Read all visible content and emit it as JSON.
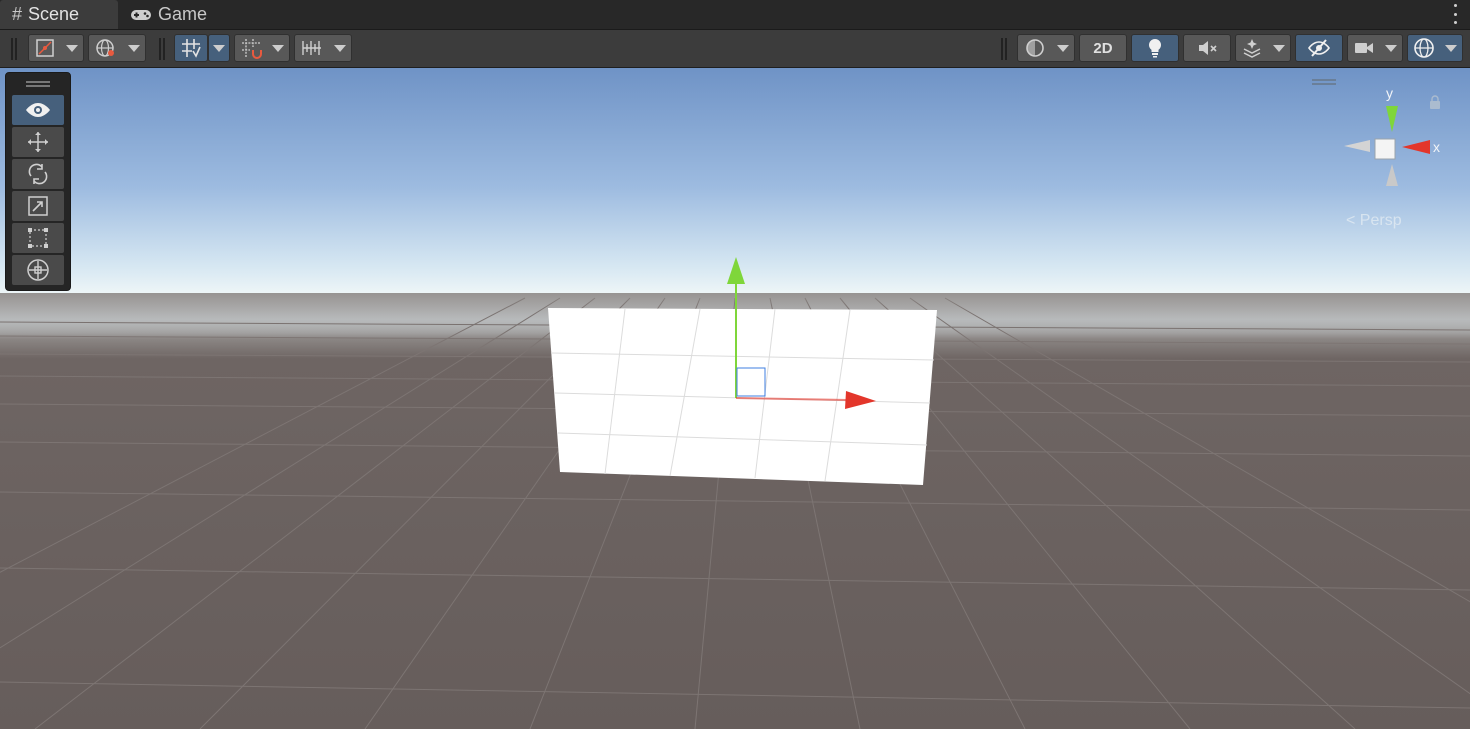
{
  "window": {
    "tabs": [
      {
        "label": "Scene",
        "icon": "hash-icon",
        "active": true
      },
      {
        "label": "Game",
        "icon": "gamepad-icon",
        "active": false
      }
    ],
    "menu_icon": "kebab-menu-icon"
  },
  "toolbar": {
    "left": [
      {
        "name": "draw-mode-dropdown",
        "icon": "shaded-mode-icon"
      },
      {
        "name": "global-local-dropdown",
        "icon": "globe-icon"
      },
      {
        "name": "grid-visibility-toggle",
        "icon": "grid-icon",
        "active": true
      },
      {
        "name": "grid-snapping-dropdown",
        "icon": "grid-snap-icon"
      },
      {
        "name": "increment-snap-dropdown",
        "icon": "ruler-icon"
      }
    ],
    "right": [
      {
        "name": "render-mode-dropdown",
        "icon": "sphere-icon"
      },
      {
        "name": "2d-toggle",
        "label": "2D"
      },
      {
        "name": "lighting-toggle",
        "icon": "lightbulb-icon",
        "active": true
      },
      {
        "name": "audio-toggle",
        "icon": "mute-speaker-icon"
      },
      {
        "name": "effects-dropdown",
        "icon": "effects-icon"
      },
      {
        "name": "scene-visibility-toggle",
        "icon": "eye-slash-icon",
        "active": true
      },
      {
        "name": "camera-dropdown",
        "icon": "camera-icon"
      },
      {
        "name": "gizmos-dropdown",
        "icon": "gizmo-icon",
        "active": true
      }
    ]
  },
  "tools": [
    {
      "name": "view-tool",
      "icon": "eye-icon",
      "active": true
    },
    {
      "name": "move-tool",
      "icon": "move-arrows-icon"
    },
    {
      "name": "rotate-tool",
      "icon": "rotate-icon"
    },
    {
      "name": "scale-tool",
      "icon": "scale-icon"
    },
    {
      "name": "rect-tool",
      "icon": "rect-tool-icon"
    },
    {
      "name": "transform-tool",
      "icon": "transform-icon"
    }
  ],
  "orientation_gizmo": {
    "y_label": "y",
    "x_label": "x",
    "projection_label": "Persp"
  },
  "colors": {
    "x_axis": "#e3362b",
    "y_axis": "#7fd63a",
    "z_axis": "#3f7fe0",
    "active_button": "#46607c"
  }
}
